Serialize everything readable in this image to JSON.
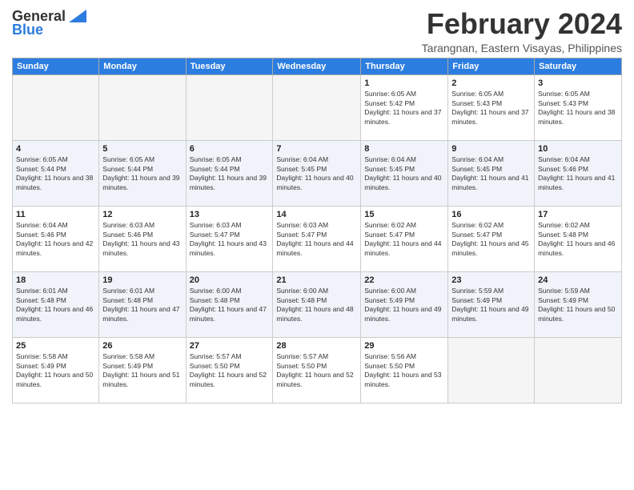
{
  "logo": {
    "general": "General",
    "blue": "Blue"
  },
  "header": {
    "month_year": "February 2024",
    "location": "Tarangnan, Eastern Visayas, Philippines"
  },
  "days_of_week": [
    "Sunday",
    "Monday",
    "Tuesday",
    "Wednesday",
    "Thursday",
    "Friday",
    "Saturday"
  ],
  "weeks": [
    [
      {
        "day": "",
        "empty": true
      },
      {
        "day": "",
        "empty": true
      },
      {
        "day": "",
        "empty": true
      },
      {
        "day": "",
        "empty": true
      },
      {
        "day": "1",
        "sunrise": "6:05 AM",
        "sunset": "5:42 PM",
        "daylight": "11 hours and 37 minutes."
      },
      {
        "day": "2",
        "sunrise": "6:05 AM",
        "sunset": "5:43 PM",
        "daylight": "11 hours and 37 minutes."
      },
      {
        "day": "3",
        "sunrise": "6:05 AM",
        "sunset": "5:43 PM",
        "daylight": "11 hours and 38 minutes."
      }
    ],
    [
      {
        "day": "4",
        "sunrise": "6:05 AM",
        "sunset": "5:44 PM",
        "daylight": "11 hours and 38 minutes."
      },
      {
        "day": "5",
        "sunrise": "6:05 AM",
        "sunset": "5:44 PM",
        "daylight": "11 hours and 39 minutes."
      },
      {
        "day": "6",
        "sunrise": "6:05 AM",
        "sunset": "5:44 PM",
        "daylight": "11 hours and 39 minutes."
      },
      {
        "day": "7",
        "sunrise": "6:04 AM",
        "sunset": "5:45 PM",
        "daylight": "11 hours and 40 minutes."
      },
      {
        "day": "8",
        "sunrise": "6:04 AM",
        "sunset": "5:45 PM",
        "daylight": "11 hours and 40 minutes."
      },
      {
        "day": "9",
        "sunrise": "6:04 AM",
        "sunset": "5:45 PM",
        "daylight": "11 hours and 41 minutes."
      },
      {
        "day": "10",
        "sunrise": "6:04 AM",
        "sunset": "5:46 PM",
        "daylight": "11 hours and 41 minutes."
      }
    ],
    [
      {
        "day": "11",
        "sunrise": "6:04 AM",
        "sunset": "5:46 PM",
        "daylight": "11 hours and 42 minutes."
      },
      {
        "day": "12",
        "sunrise": "6:03 AM",
        "sunset": "5:46 PM",
        "daylight": "11 hours and 43 minutes."
      },
      {
        "day": "13",
        "sunrise": "6:03 AM",
        "sunset": "5:47 PM",
        "daylight": "11 hours and 43 minutes."
      },
      {
        "day": "14",
        "sunrise": "6:03 AM",
        "sunset": "5:47 PM",
        "daylight": "11 hours and 44 minutes."
      },
      {
        "day": "15",
        "sunrise": "6:02 AM",
        "sunset": "5:47 PM",
        "daylight": "11 hours and 44 minutes."
      },
      {
        "day": "16",
        "sunrise": "6:02 AM",
        "sunset": "5:47 PM",
        "daylight": "11 hours and 45 minutes."
      },
      {
        "day": "17",
        "sunrise": "6:02 AM",
        "sunset": "5:48 PM",
        "daylight": "11 hours and 46 minutes."
      }
    ],
    [
      {
        "day": "18",
        "sunrise": "6:01 AM",
        "sunset": "5:48 PM",
        "daylight": "11 hours and 46 minutes."
      },
      {
        "day": "19",
        "sunrise": "6:01 AM",
        "sunset": "5:48 PM",
        "daylight": "11 hours and 47 minutes."
      },
      {
        "day": "20",
        "sunrise": "6:00 AM",
        "sunset": "5:48 PM",
        "daylight": "11 hours and 47 minutes."
      },
      {
        "day": "21",
        "sunrise": "6:00 AM",
        "sunset": "5:48 PM",
        "daylight": "11 hours and 48 minutes."
      },
      {
        "day": "22",
        "sunrise": "6:00 AM",
        "sunset": "5:49 PM",
        "daylight": "11 hours and 49 minutes."
      },
      {
        "day": "23",
        "sunrise": "5:59 AM",
        "sunset": "5:49 PM",
        "daylight": "11 hours and 49 minutes."
      },
      {
        "day": "24",
        "sunrise": "5:59 AM",
        "sunset": "5:49 PM",
        "daylight": "11 hours and 50 minutes."
      }
    ],
    [
      {
        "day": "25",
        "sunrise": "5:58 AM",
        "sunset": "5:49 PM",
        "daylight": "11 hours and 50 minutes."
      },
      {
        "day": "26",
        "sunrise": "5:58 AM",
        "sunset": "5:49 PM",
        "daylight": "11 hours and 51 minutes."
      },
      {
        "day": "27",
        "sunrise": "5:57 AM",
        "sunset": "5:50 PM",
        "daylight": "11 hours and 52 minutes."
      },
      {
        "day": "28",
        "sunrise": "5:57 AM",
        "sunset": "5:50 PM",
        "daylight": "11 hours and 52 minutes."
      },
      {
        "day": "29",
        "sunrise": "5:56 AM",
        "sunset": "5:50 PM",
        "daylight": "11 hours and 53 minutes."
      },
      {
        "day": "",
        "empty": true
      },
      {
        "day": "",
        "empty": true
      }
    ]
  ]
}
